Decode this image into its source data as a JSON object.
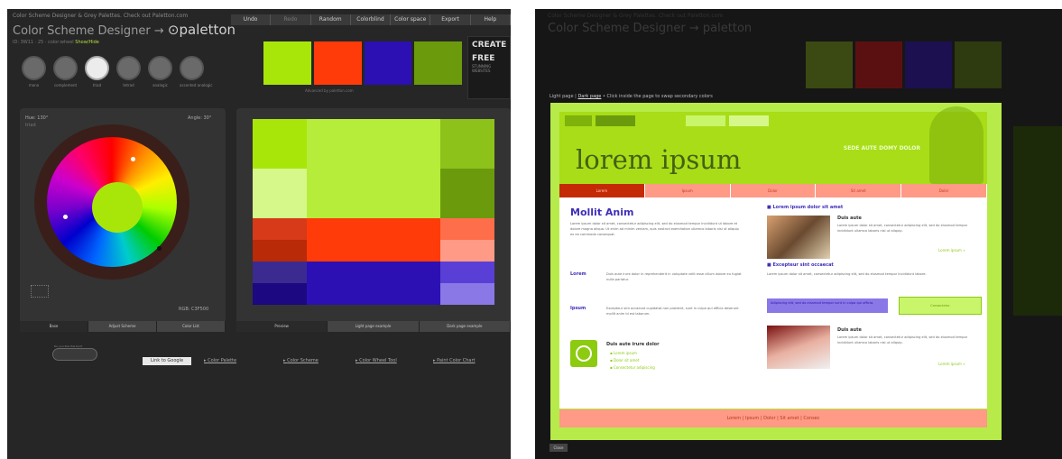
{
  "left": {
    "top_description": "Color Scheme Designer & Grey Palettes. Check out Paletton.com",
    "app_title": "Color Scheme Designer",
    "arrow": "→",
    "logo": "paletton",
    "subtitle": "ID: 3W11 · 25 · color:wheel",
    "subtitle_link": "Show/Hide",
    "menu": [
      "Undo",
      "Redo",
      "Random",
      "Colorblind",
      "Color space",
      "Export",
      "Help"
    ],
    "modes": [
      {
        "label": "mono"
      },
      {
        "label": "complement"
      },
      {
        "label": "triad"
      },
      {
        "label": "tetrad"
      },
      {
        "label": "analogic"
      },
      {
        "label": "accented analogic"
      }
    ],
    "swatches": [
      "#a8e60a",
      "#ff3b0a",
      "#2d10b3",
      "#6b9b0c"
    ],
    "swatch_caption": "Advanced by paletton.com",
    "ad": {
      "line1": "CREATE",
      "line2": "FREE",
      "line3": "STUNNING WEBSITES"
    },
    "wheel": {
      "hue_label": "Hue: 130°",
      "angle_label": "Angle: 30°",
      "mode": "triad",
      "color_label": "RGB: C3F500"
    },
    "wheel_tabs": [
      "Base",
      "Adjust Scheme",
      "Color List"
    ],
    "preview_tabs": [
      "Preview",
      "Light page example",
      "Dark page example"
    ],
    "goodies_label": "Do you like this tool?",
    "google_button": "Link to Google",
    "bottom_links": [
      "Color Palette",
      "Color Scheme",
      "Color Wheel Tool",
      "Paint Color Chart"
    ]
  },
  "right": {
    "hint_prefix": "Light page |",
    "hint_link": "Dark page",
    "hint_suffix": "• Click inside the page to swap secondary colors",
    "dim_swatches": [
      "#3b4a12",
      "#5a1010",
      "#1c1050",
      "#2e3a10"
    ],
    "mock": {
      "title": "lorem ipsum",
      "slogan": "SEDE AUTE DOMY DOLOR",
      "nav": [
        "Lorem",
        "Ipsum",
        "Dolor",
        "Sit amet",
        "Dolor"
      ],
      "left_heading": "Mollit Anim",
      "left_text": "Lorem ipsum dolor sit amet, consectetur adipiscing elit, sed do eiusmod tempor incididunt ut labore et dolore magna aliqua. Ut enim ad minim veniam, quis nostrud exercitation ullamco laboris nisi ut aliquip ex ea commodo consequat.",
      "item1_label": "Lorem",
      "item1_text": "Duis aute irure dolor in reprehenderit in voluptate velit esse cillum dolore eu fugiat nulla pariatur.",
      "item2_label": "Ipsum",
      "item2_text": "Excepteur sint occaecat cupidatat non proident, sunt in culpa qui officia deserunt mollit anim id est laborum.",
      "box_heading": "Duis aute irure dolor",
      "box_links": [
        "Lorem ipsum",
        "Dolor sit amet",
        "Consectetur adipiscing"
      ],
      "r1_heading": "Lorem ipsum dolor sit amet",
      "r1_sub": "Duis aute",
      "r1_text": "Lorem ipsum dolor sit amet, consectetur adipiscing elit, sed do eiusmod tempor incididunt ullamco laboris nisi ut aliquip.",
      "r1_more": "Lorem ipsum »",
      "r2_heading": "Excepteur sint occaecat",
      "r2_text": "Lorem ipsum dolor sit amet, consectetur adipiscing elit, sed do eiusmod tempor incididunt labore.",
      "purple_box": "Adipiscing elit, sed do eiusmod tempor sunt in culpa qui officia.",
      "green_btn": "Consectetur",
      "r3_sub": "Duis aute",
      "r3_text": "Lorem ipsum dolor sit amet, consectetur adipiscing elit, sed do eiusmod tempor incididunt ullamco laboris nisi ut aliquip.",
      "r3_more": "Lorem ipsum »",
      "footer": "Lorem | Ipsum | Dolor | Sit amet | Consec"
    },
    "close": "Close"
  }
}
